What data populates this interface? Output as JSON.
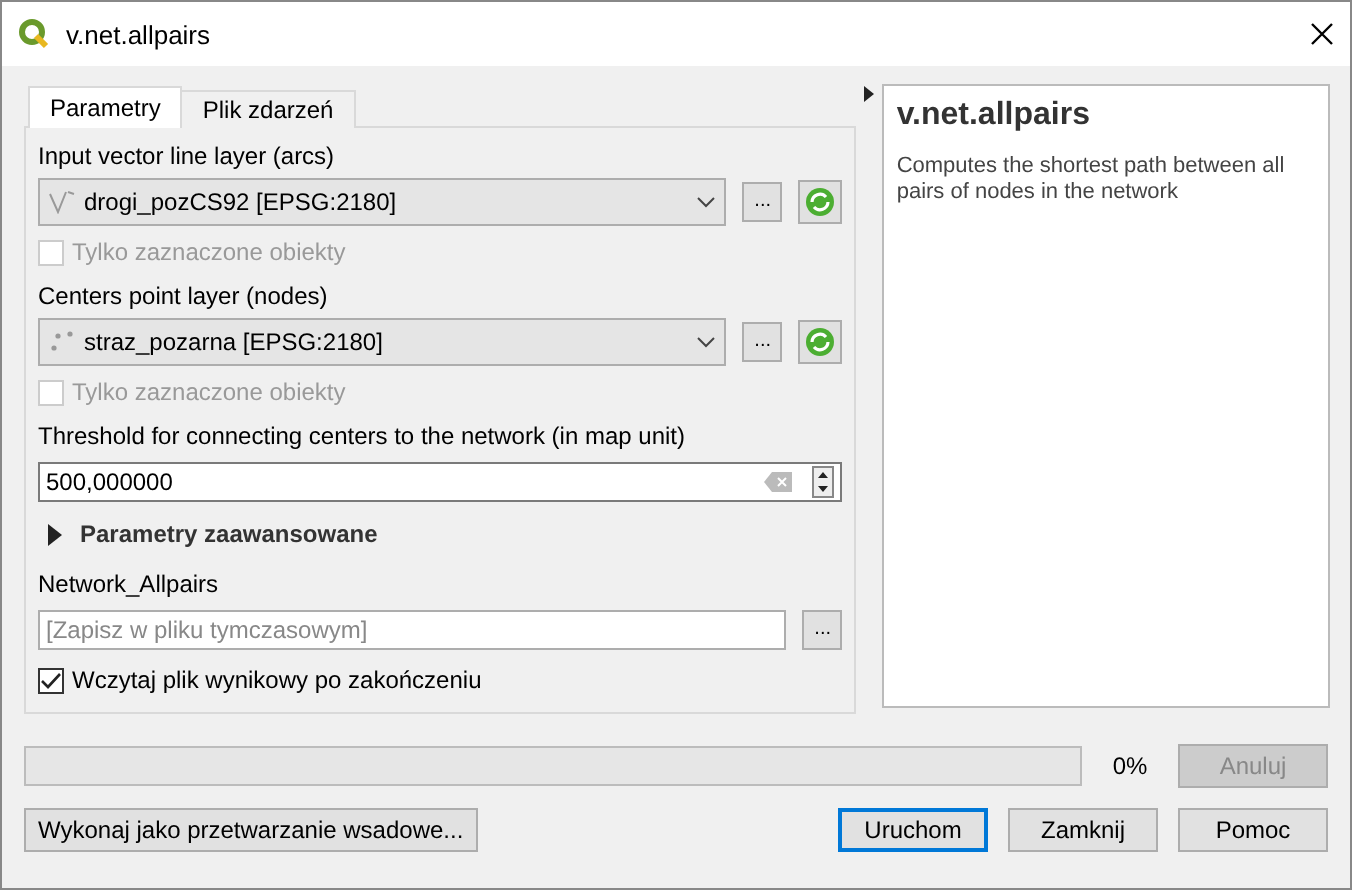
{
  "window": {
    "title": "v.net.allpairs"
  },
  "tabs": [
    {
      "label": "Parametry",
      "selected": true
    },
    {
      "label": "Plik zdarzeń",
      "selected": false
    }
  ],
  "parameters": [
    {
      "kind": "layer",
      "label": "Input vector line layer (arcs)",
      "layer": {
        "kind": "line",
        "name": "drogi_pozCS92 [EPSG:2180]"
      },
      "browse": "...",
      "selected_only": {
        "label": "Tylko zaznaczone obiekty",
        "checked": false,
        "disabled": true
      }
    },
    {
      "kind": "layer",
      "label": "Centers point layer (nodes)",
      "layer": {
        "kind": "point",
        "name": "straz_pozarna [EPSG:2180]"
      },
      "browse": "...",
      "selected_only": {
        "label": "Tylko zaznaczone obiekty",
        "checked": false,
        "disabled": true
      }
    },
    {
      "kind": "number",
      "label": "Threshold for connecting centers to the network (in map unit)",
      "value": "500,000000"
    },
    {
      "kind": "section",
      "label": "Parametry zaawansowane",
      "expanded": false
    },
    {
      "kind": "output",
      "label": "Network_Allpairs",
      "placeholder": "[Zapisz w pliku tymczasowym]",
      "browse": "..."
    },
    {
      "kind": "checkbox",
      "label": "Wczytaj plik wynikowy po zakończeniu",
      "checked": true
    }
  ],
  "help": {
    "title": "v.net.allpairs",
    "text": "Computes the shortest path between all pairs of nodes in the network"
  },
  "progress": {
    "level": 0,
    "reading": "0%",
    "cancel": {
      "label": "Anuluj",
      "disabled": true
    }
  },
  "buttons": [
    {
      "label": "Wykonaj jako przetwarzanie wsadowe...",
      "default": false
    },
    {
      "label": "Uruchom",
      "default": true
    },
    {
      "label": "Zamknij",
      "default": false
    },
    {
      "label": "Pomoc",
      "default": false
    }
  ]
}
